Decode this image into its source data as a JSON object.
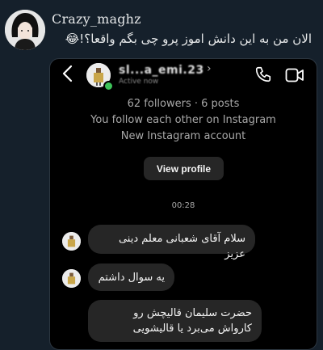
{
  "tweet": {
    "username": "Crazy_maghz",
    "text": "الان من به این دانش اموز پرو چی بگم واقعا؟!😂"
  },
  "chat": {
    "header": {
      "username": "sl...a_emi.23",
      "status": "Active now"
    },
    "profile": {
      "stats": "62 followers · 6 posts",
      "follow_status": "You follow each other on Instagram",
      "account_note": "New Instagram account",
      "view_profile_label": "View profile"
    },
    "timestamp": "00:28",
    "messages": [
      "سلام آقای شعبانی معلم دینی عزیز",
      "یه سوال داشتم",
      "حضرت سلیمان قالیچش رو کارواش می‌برد یا قالیشویی"
    ]
  },
  "colors": {
    "page_bg": "#15202b",
    "chat_bg": "#000000",
    "bubble_bg": "#262626",
    "button_bg": "#262626",
    "online": "#3ec35a"
  }
}
